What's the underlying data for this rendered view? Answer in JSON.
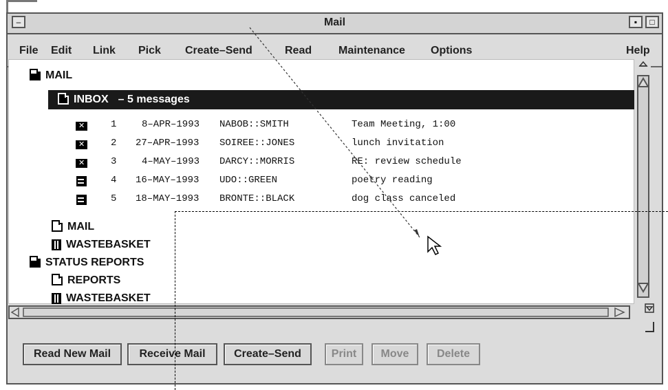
{
  "window": {
    "title": "Mail"
  },
  "menubar": {
    "file": "File",
    "edit": "Edit",
    "link": "Link",
    "pick": "Pick",
    "create_send": "Create–Send",
    "read": "Read",
    "maintenance": "Maintenance",
    "options": "Options",
    "help": "Help"
  },
  "tree": {
    "mail_root": "MAIL",
    "inbox_label": "INBOX",
    "inbox_count": "– 5 messages",
    "messages": [
      {
        "num": "1",
        "date": "8–APR–1993",
        "from": "NABOB::SMITH",
        "subject": "Team Meeting, 1:00",
        "state": "unread"
      },
      {
        "num": "2",
        "date": "27–APR–1993",
        "from": "SOIREE::JONES",
        "subject": "lunch invitation",
        "state": "unread"
      },
      {
        "num": "3",
        "date": "4–MAY–1993",
        "from": "DARCY::MORRIS",
        "subject": "RE: review schedule",
        "state": "unread"
      },
      {
        "num": "4",
        "date": "16–MAY–1993",
        "from": "UDO::GREEN",
        "subject": "poetry reading",
        "state": "read"
      },
      {
        "num": "5",
        "date": "18–MAY–1993",
        "from": "BRONTE::BLACK",
        "subject": "dog class canceled",
        "state": "read"
      }
    ],
    "mail_sub": "MAIL",
    "wastebasket_1": "WASTEBASKET",
    "status_reports": "STATUS REPORTS",
    "reports": "REPORTS",
    "wastebasket_2": "WASTEBASKET"
  },
  "buttons": {
    "read_new_mail": "Read New Mail",
    "receive_mail": "Receive Mail",
    "create_send": "Create–Send",
    "print": "Print",
    "move": "Move",
    "delete": "Delete"
  }
}
